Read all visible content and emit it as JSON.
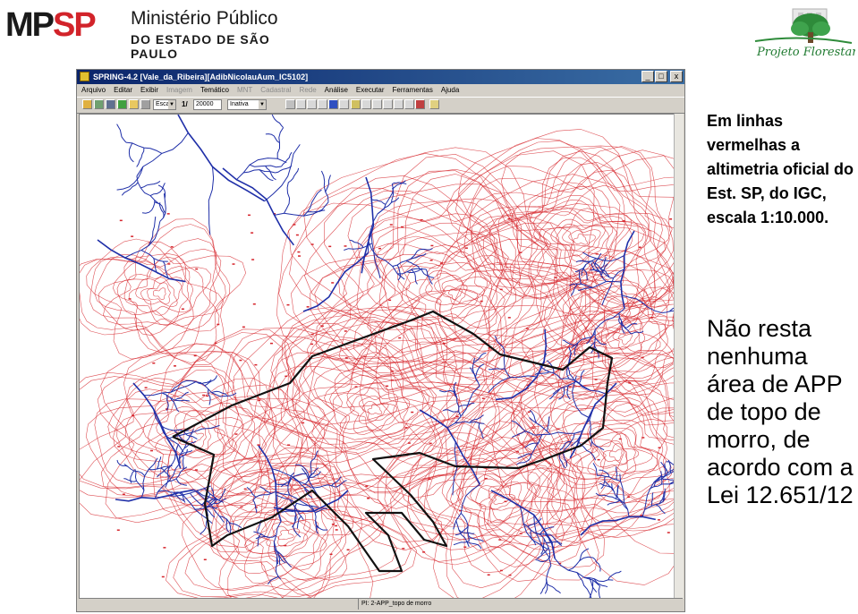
{
  "header": {
    "org_logo_mp": "MP",
    "org_logo_sp": "SP",
    "org_name_line1": "Ministério Público",
    "org_name_line2": "DO ESTADO DE SÃO PAULO",
    "partner_logo_text": "Projeto Florestar"
  },
  "app": {
    "title": "SPRING-4.2 [Vale_da_Ribeira][AdibNicolauAum_IC5102]",
    "window_buttons": [
      "_",
      "□",
      "x"
    ],
    "menu": [
      {
        "label": "Arquivo",
        "enabled": true
      },
      {
        "label": "Editar",
        "enabled": true
      },
      {
        "label": "Exibir",
        "enabled": true
      },
      {
        "label": "Imagem",
        "enabled": false
      },
      {
        "label": "Temático",
        "enabled": true
      },
      {
        "label": "MNT",
        "enabled": false
      },
      {
        "label": "Cadastral",
        "enabled": false
      },
      {
        "label": "Rede",
        "enabled": false
      },
      {
        "label": "Análise",
        "enabled": true
      },
      {
        "label": "Executar",
        "enabled": true
      },
      {
        "label": "Ferramentas",
        "enabled": true
      },
      {
        "label": "Ajuda",
        "enabled": true
      }
    ],
    "toolbar": {
      "scale_mode": "Escal",
      "scale_prefix": "1/",
      "scale_value": "20000",
      "state_value": "Inativa"
    },
    "status": {
      "plan_label": "PI: 2-APP_topo de morro"
    }
  },
  "slide": {
    "note_small": "Em linhas vermelhas a altimetria oficial do Est. SP, do IGC, escala 1:10.000.",
    "note_large": "Não resta nenhuma área de APP de topo de morro, de acordo com a Lei 12.651/12"
  },
  "colors": {
    "contour": "#d6242b",
    "drainage": "#1f2fa8",
    "boundary": "#111111",
    "titlebar": "#0a246a",
    "brand_red": "#d2232a"
  }
}
